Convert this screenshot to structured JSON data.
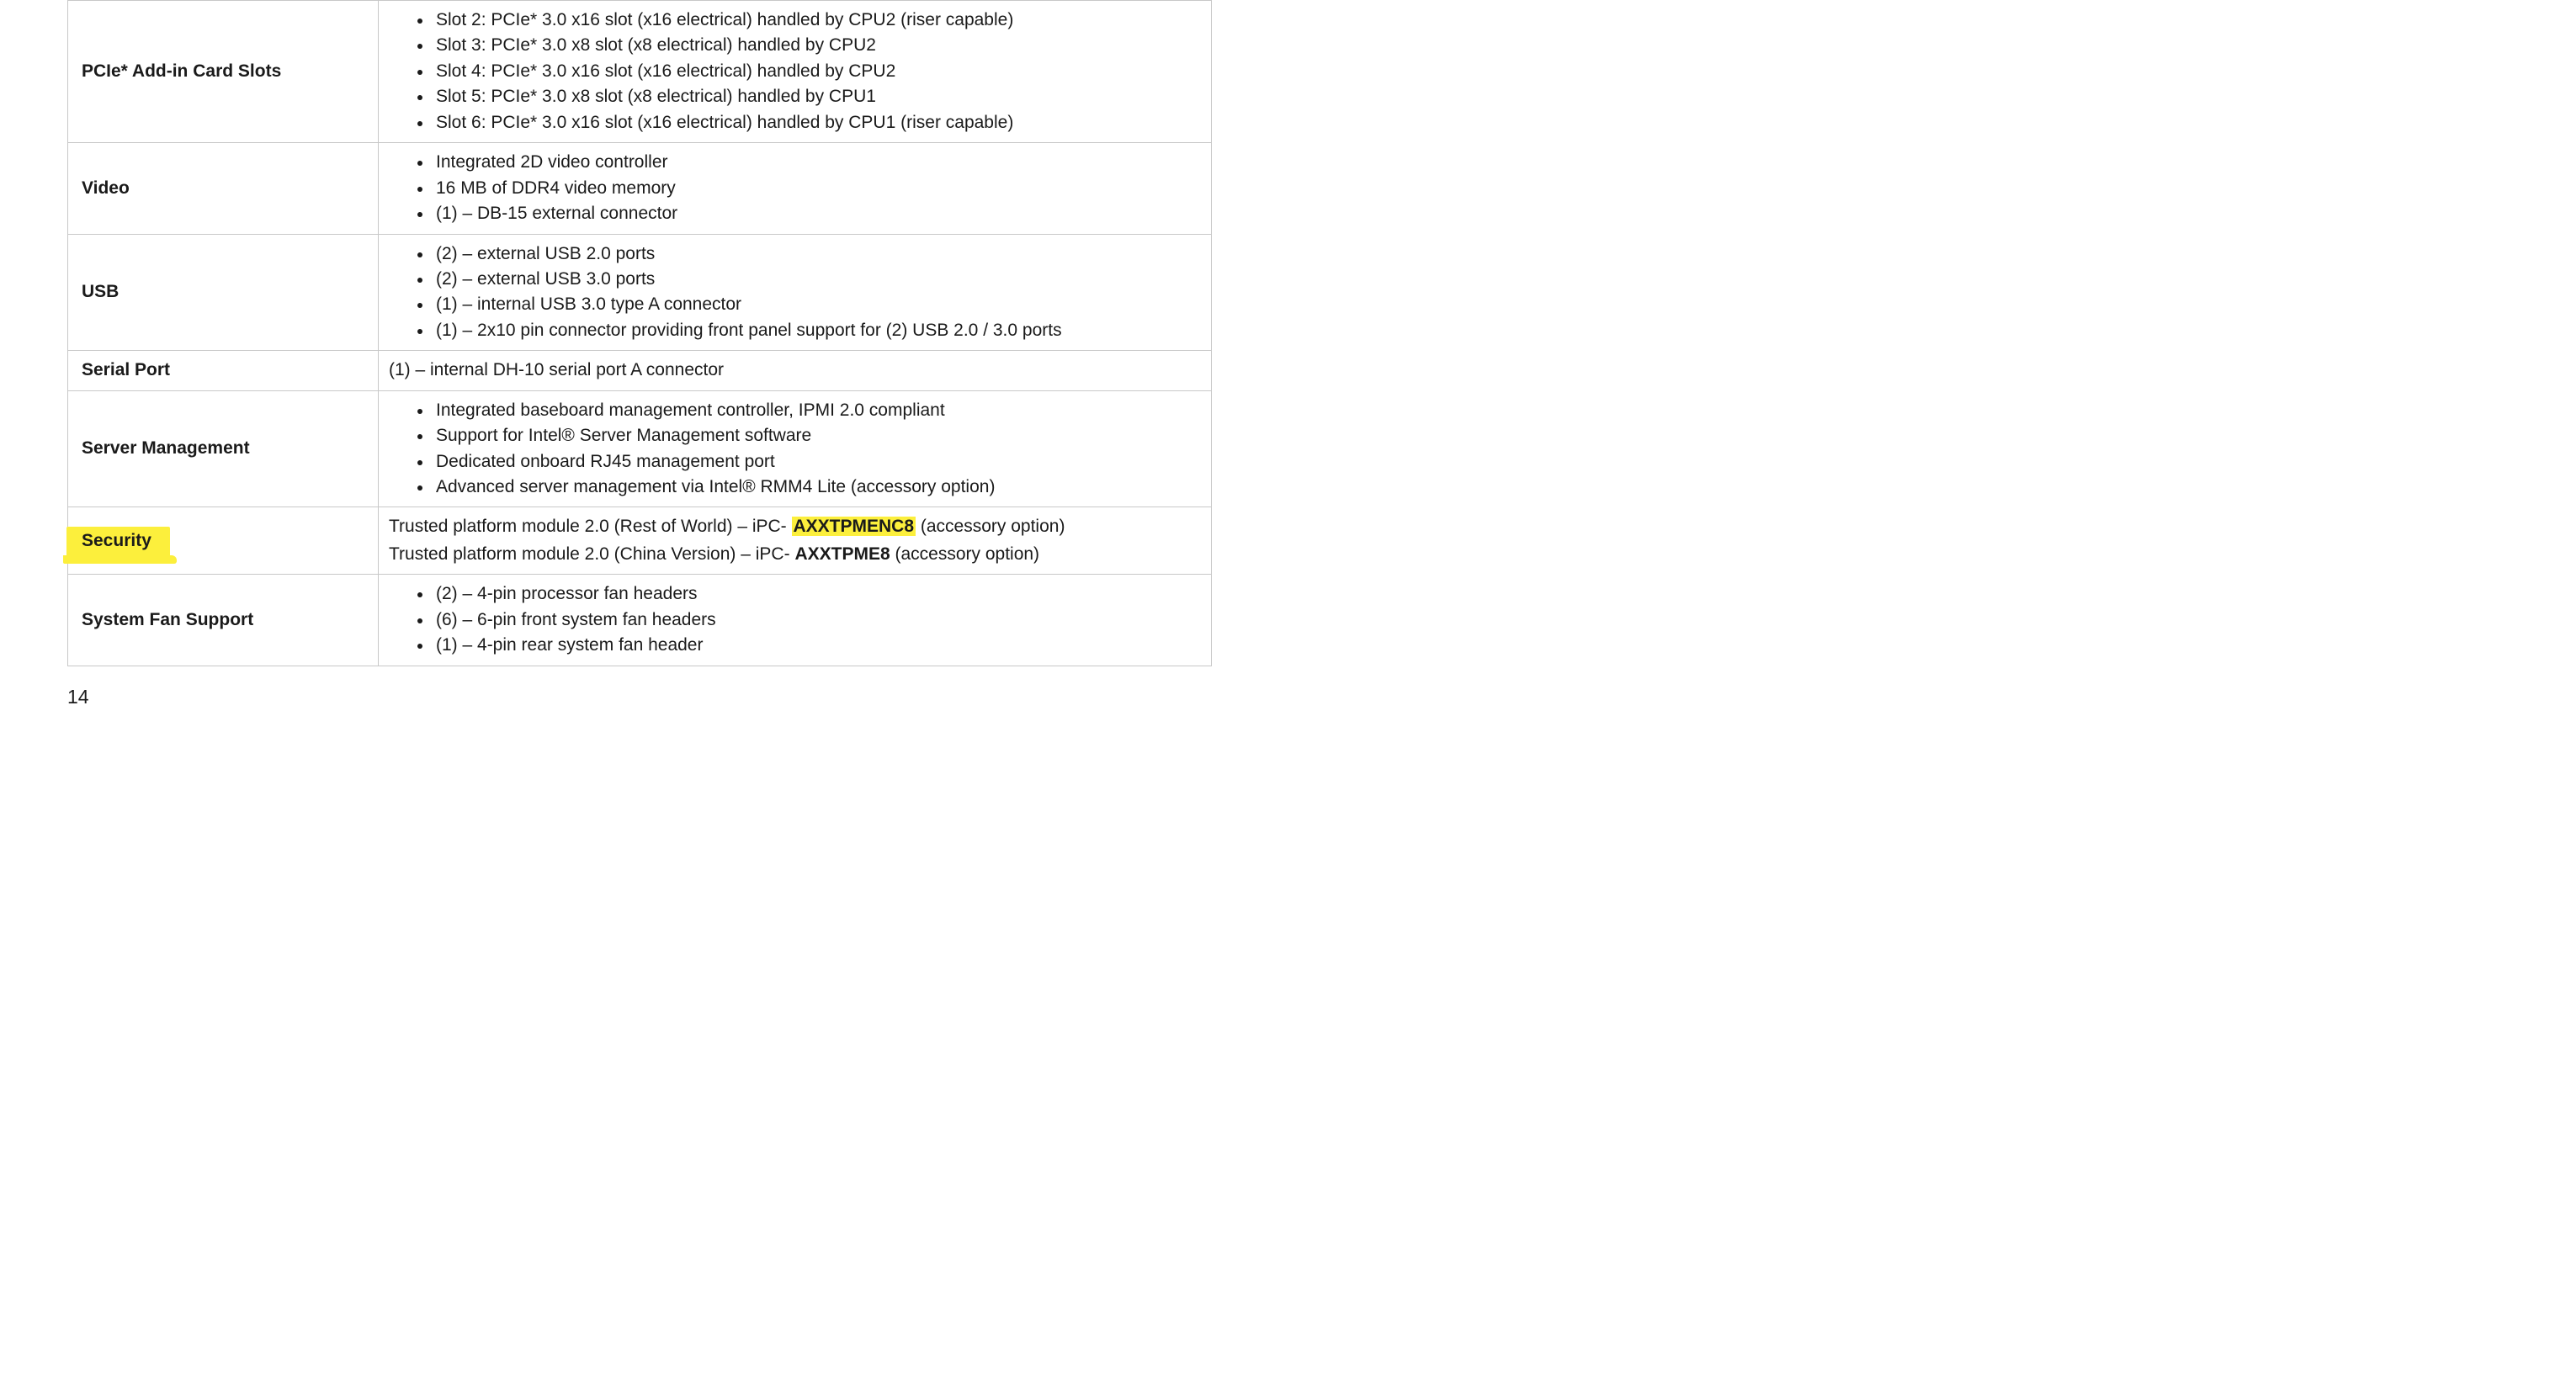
{
  "page_number": "14",
  "rows": {
    "pcie": {
      "label": "PCIe* Add-in Card Slots",
      "items": [
        "Slot 2: PCIe* 3.0 x16 slot (x16 electrical) handled by CPU2 (riser capable)",
        "Slot 3: PCIe* 3.0 x8 slot (x8 electrical) handled by CPU2",
        "Slot 4: PCIe* 3.0 x16 slot (x16 electrical) handled by CPU2",
        "Slot 5: PCIe* 3.0 x8 slot (x8 electrical) handled by CPU1",
        "Slot 6: PCIe* 3.0 x16 slot (x16 electrical) handled by CPU1 (riser capable)"
      ]
    },
    "video": {
      "label": "Video",
      "items": [
        "Integrated 2D video controller",
        "16 MB of DDR4 video memory",
        "(1) – DB-15 external connector"
      ]
    },
    "usb": {
      "label": "USB",
      "items": [
        "(2) – external USB 2.0 ports",
        "(2) – external USB 3.0 ports",
        "(1) – internal USB 3.0 type A connector",
        "(1) – 2x10 pin connector providing front panel support for (2) USB 2.0 / 3.0 ports"
      ]
    },
    "serial": {
      "label": "Serial Port",
      "text": "(1) – internal DH-10 serial port A connector"
    },
    "mgmt": {
      "label": "Server Management",
      "items": [
        "Integrated baseboard management controller, IPMI 2.0 compliant",
        "Support for Intel® Server Management software",
        "Dedicated onboard RJ45 management port",
        "Advanced server management via Intel® RMM4 Lite (accessory option)"
      ]
    },
    "security": {
      "label": "Security",
      "line1_pre": "Trusted platform module 2.0 (Rest of World) – iPC- ",
      "line1_bold": "AXXTPMENC8",
      "line1_post": " (accessory option)",
      "line2_pre": "Trusted platform module 2.0 (China Version) – iPC- ",
      "line2_bold": "AXXTPME8",
      "line2_post": " (accessory option)"
    },
    "fans": {
      "label": "System Fan Support",
      "items": [
        "(2) – 4-pin processor fan headers",
        "(6) – 6-pin front system fan headers",
        "(1) – 4-pin rear system fan header"
      ]
    }
  }
}
